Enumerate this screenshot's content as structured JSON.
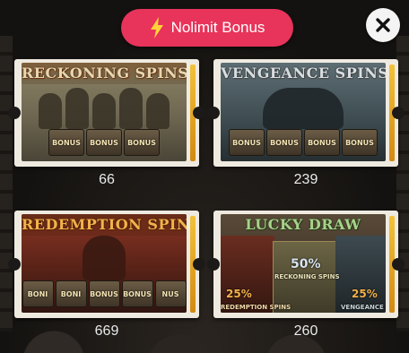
{
  "header": {
    "bonus_label": "Nolimit Bonus",
    "bonus_icon": "lightning-bolt-icon",
    "accent": "#e8335a"
  },
  "close_icon": "close-icon",
  "bonuses": [
    {
      "title": "RECKONING SPINS",
      "chest_labels": [
        "BONUS",
        "BONUS",
        "BONUS"
      ],
      "count": "66"
    },
    {
      "title": "VENGEANCE SPINS",
      "chest_labels": [
        "BONUS",
        "BONUS",
        "BONUS",
        "BONUS"
      ],
      "count": "239"
    },
    {
      "title": "REDEMPTION SPINS",
      "chest_labels": [
        "BONI",
        "BONI",
        "BONUS",
        "BONUS",
        "NUS"
      ],
      "count": "669"
    },
    {
      "title": "LUCKY DRAW",
      "draws": [
        {
          "percent": "25%",
          "label": "REDEMPTION SPINS"
        },
        {
          "percent": "50%",
          "label": "RECKONING SPINS"
        },
        {
          "percent": "25%",
          "label": "VENGEANCE SPINS"
        }
      ],
      "count": "260"
    }
  ]
}
